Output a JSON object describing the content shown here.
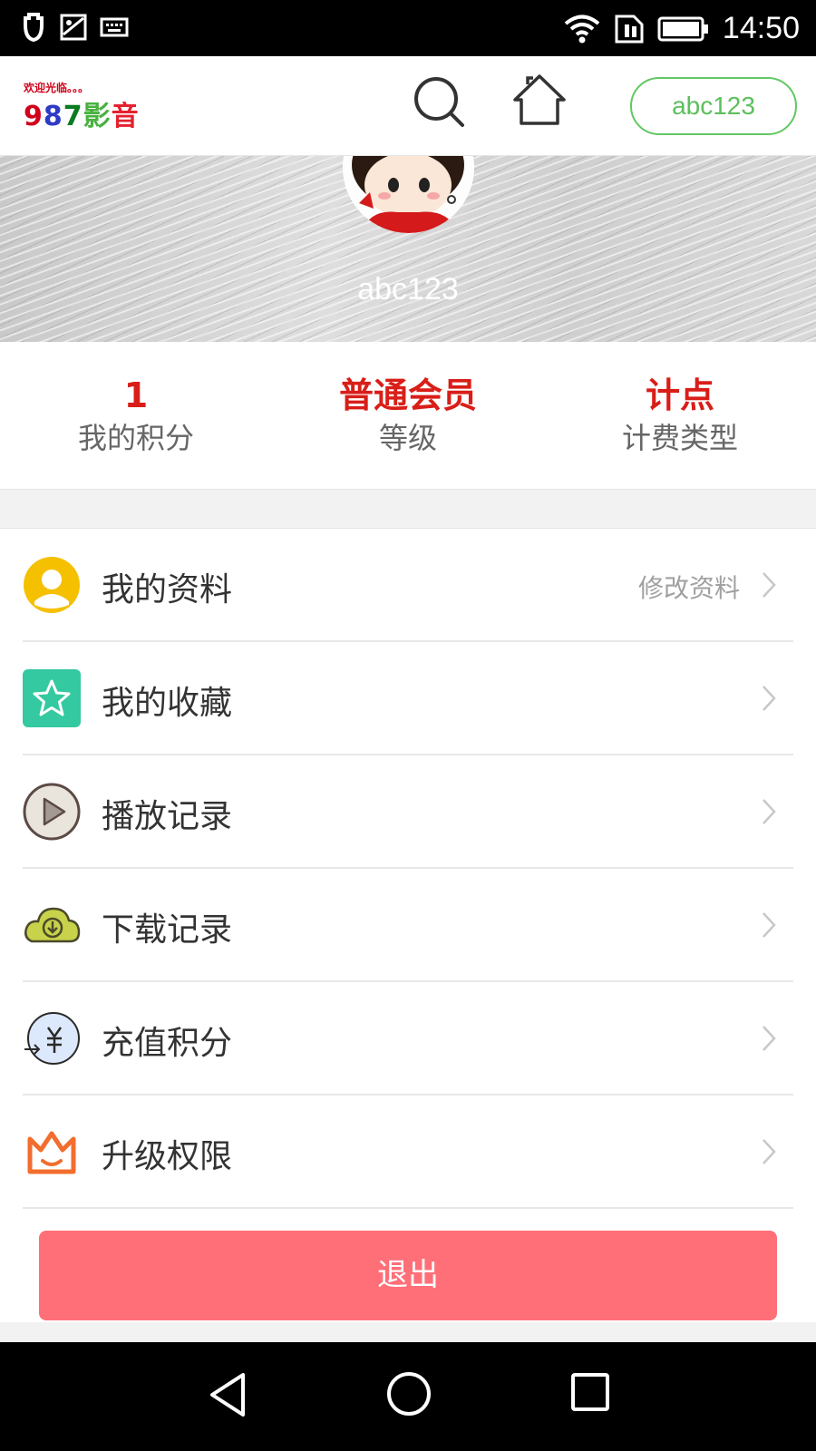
{
  "status_bar": {
    "time": "14:50",
    "icons": [
      "notification-icon",
      "image-icon",
      "keyboard-icon",
      "wifi-icon",
      "sim-icon",
      "battery-icon"
    ]
  },
  "header": {
    "logo_small": "欢迎光临。。。",
    "logo_big": [
      "9",
      "8",
      "7",
      "影",
      "音"
    ],
    "username_button": "abc123",
    "icons": [
      "search-icon",
      "home-icon"
    ]
  },
  "profile": {
    "username": "abc123"
  },
  "stats": [
    {
      "value": "1",
      "label": "我的积分"
    },
    {
      "value": "普通会员",
      "label": "等级"
    },
    {
      "value": "计点",
      "label": "计费类型"
    }
  ],
  "menu": [
    {
      "label": "我的资料",
      "hint": "修改资料",
      "icon": "user-icon",
      "color": "#f5c000"
    },
    {
      "label": "我的收藏",
      "hint": "",
      "icon": "star-icon",
      "color": "#34c9a0"
    },
    {
      "label": "播放记录",
      "hint": "",
      "icon": "play-icon",
      "color": "#e6e0d6"
    },
    {
      "label": "下载记录",
      "hint": "",
      "icon": "download-cloud-icon",
      "color": "#c8d24a"
    },
    {
      "label": "充值积分",
      "hint": "",
      "icon": "yuan-recharge-icon",
      "color": "#dce8fb"
    },
    {
      "label": "升级权限",
      "hint": "",
      "icon": "crown-icon",
      "color": "#f26d2e"
    }
  ],
  "logout_label": "退出",
  "colors": {
    "accent_red": "#d91e18",
    "logout_bg": "#ff6f78",
    "pill_green": "#62c862"
  }
}
